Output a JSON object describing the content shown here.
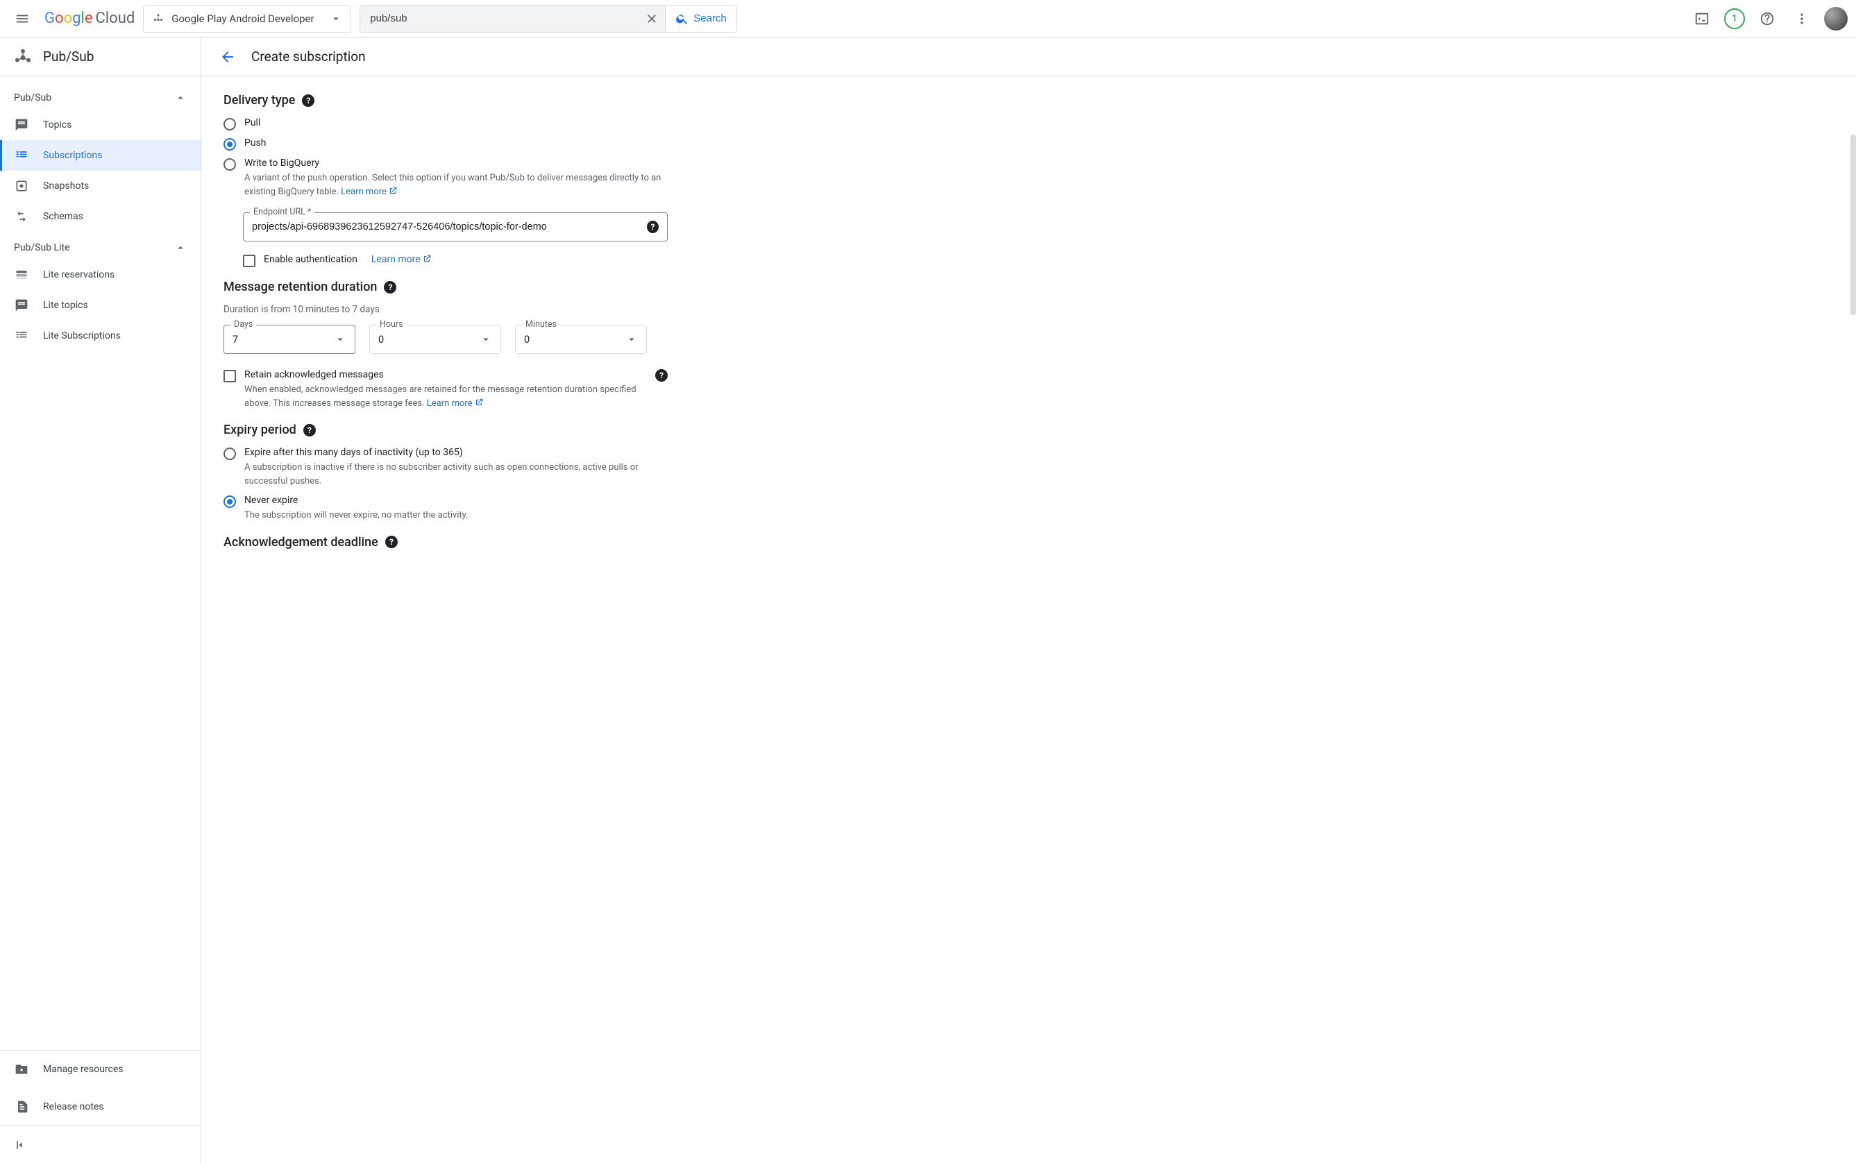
{
  "header": {
    "logo_google": "Google",
    "logo_cloud": "Cloud",
    "project_name": "Google Play Android Developer",
    "search_value": "pub/sub",
    "search_button": "Search",
    "badge_count": "1"
  },
  "sidebar": {
    "product_title": "Pub/Sub",
    "sections": [
      {
        "label": "Pub/Sub",
        "items": [
          {
            "label": "Topics",
            "active": false
          },
          {
            "label": "Subscriptions",
            "active": true
          },
          {
            "label": "Snapshots",
            "active": false
          },
          {
            "label": "Schemas",
            "active": false
          }
        ]
      },
      {
        "label": "Pub/Sub Lite",
        "items": [
          {
            "label": "Lite reservations",
            "active": false
          },
          {
            "label": "Lite topics",
            "active": false
          },
          {
            "label": "Lite Subscriptions",
            "active": false
          }
        ]
      }
    ],
    "footer": [
      {
        "label": "Manage resources"
      },
      {
        "label": "Release notes"
      }
    ]
  },
  "main": {
    "page_title": "Create subscription",
    "delivery": {
      "heading": "Delivery type",
      "options": {
        "pull": "Pull",
        "push": "Push",
        "bigquery": "Write to BigQuery",
        "bigquery_desc": "A variant of the push operation. Select this option if you want Pub/Sub to deliver messages directly to an existing BigQuery table.",
        "learn_more": "Learn more"
      },
      "endpoint_label": "Endpoint URL *",
      "endpoint_value": "projects/api-6968939623612592747-526406/topics/topic-for-demo",
      "enable_auth": "Enable authentication",
      "enable_auth_learn": "Learn more"
    },
    "retention": {
      "heading": "Message retention duration",
      "helper": "Duration is from 10 minutes to 7 days",
      "days_label": "Days",
      "days_value": "7",
      "hours_label": "Hours",
      "hours_value": "0",
      "minutes_label": "Minutes",
      "minutes_value": "0",
      "retain_label": "Retain acknowledged messages",
      "retain_desc": "When enabled, acknowledged messages are retained for the message retention duration specified above. This increases message storage fees. ",
      "retain_learn": "Learn more"
    },
    "expiry": {
      "heading": "Expiry period",
      "expire_after": "Expire after this many days of inactivity (up to 365)",
      "expire_after_desc": "A subscription is inactive if there is no subscriber activity such as open connections, active pulls or successful pushes.",
      "never": "Never expire",
      "never_desc": "The subscription will never expire, no matter the activity."
    },
    "ack": {
      "heading": "Acknowledgement deadline"
    }
  }
}
